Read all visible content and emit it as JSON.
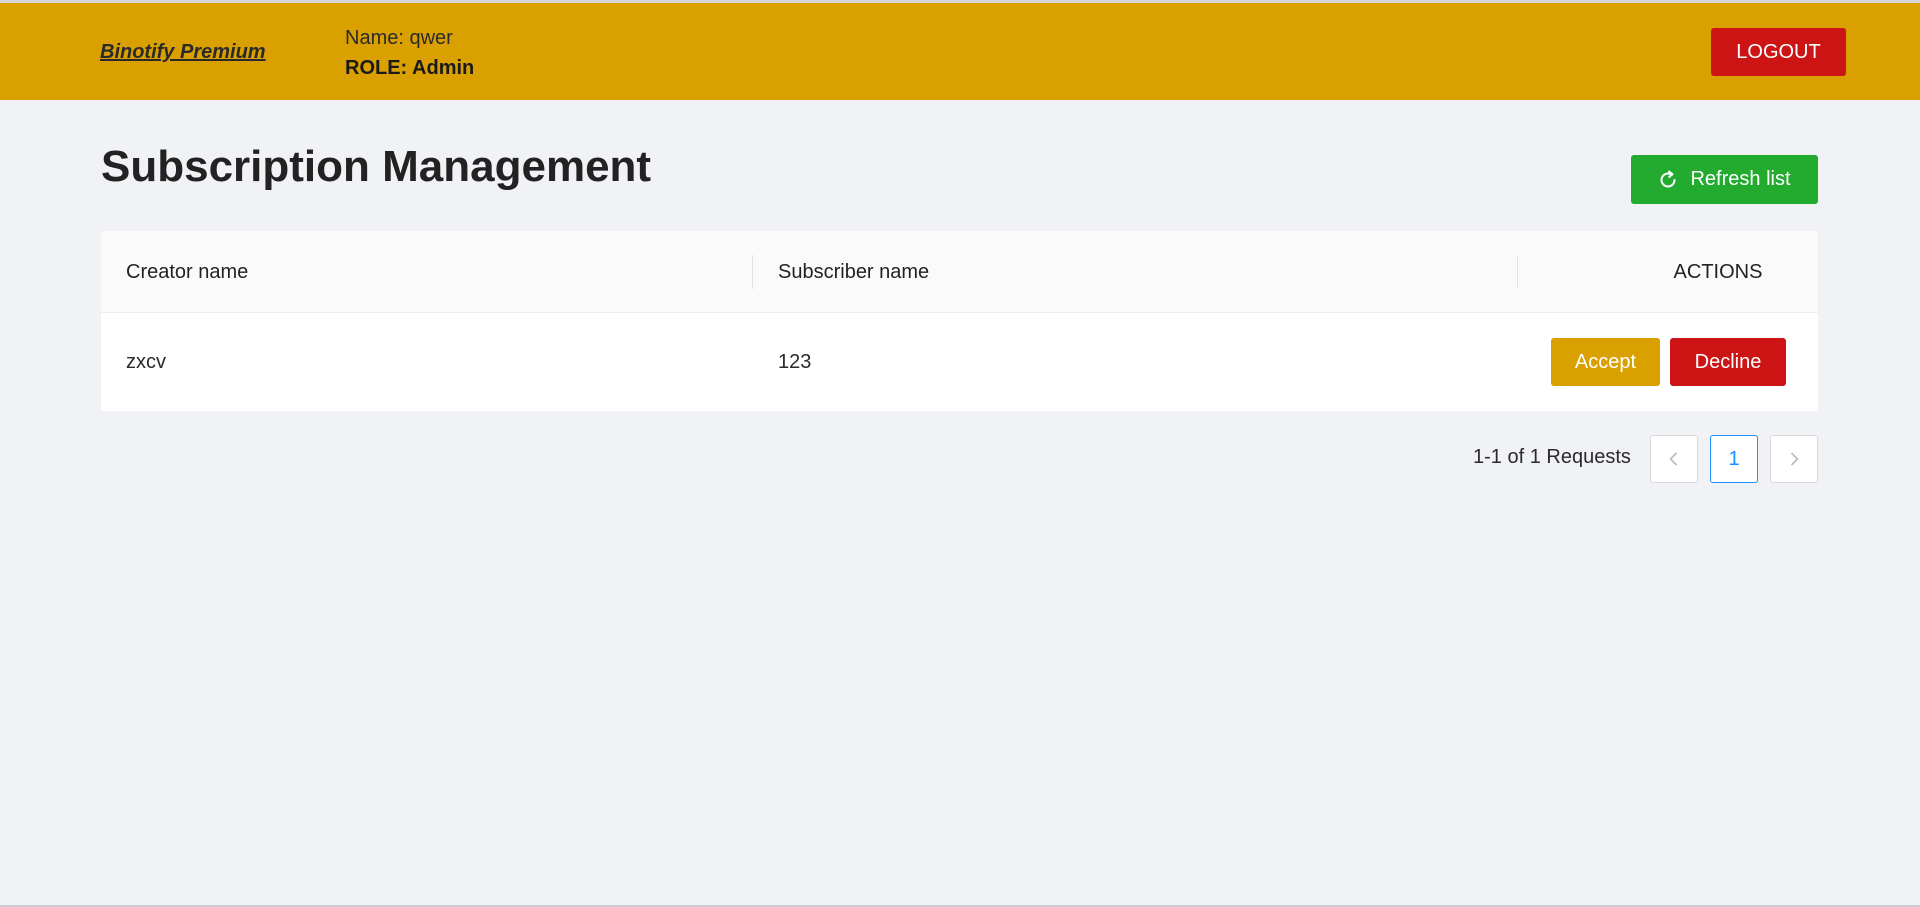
{
  "header": {
    "brand": "Binotify Premium",
    "user_name": "Name: qwer",
    "user_role": "ROLE: Admin",
    "logout_label": "LOGOUT"
  },
  "main": {
    "title": "Subscription Management",
    "refresh_label": "Refresh list"
  },
  "table": {
    "columns": [
      "Creator name",
      "Subscriber name",
      "ACTIONS"
    ],
    "rows": [
      {
        "creator": "zxcv",
        "subscriber": "123",
        "accept_label": "Accept",
        "decline_label": "Decline"
      }
    ]
  },
  "pagination": {
    "summary": "1-1 of 1 Requests",
    "current_page": "1",
    "prev_icon": "chevron-left-icon",
    "next_icon": "chevron-right-icon"
  },
  "colors": {
    "header_bg": "#daa000",
    "danger": "#cc1414",
    "success": "#23ab2f",
    "accent": "#1890ff",
    "page_bg": "#f0f2f5"
  }
}
